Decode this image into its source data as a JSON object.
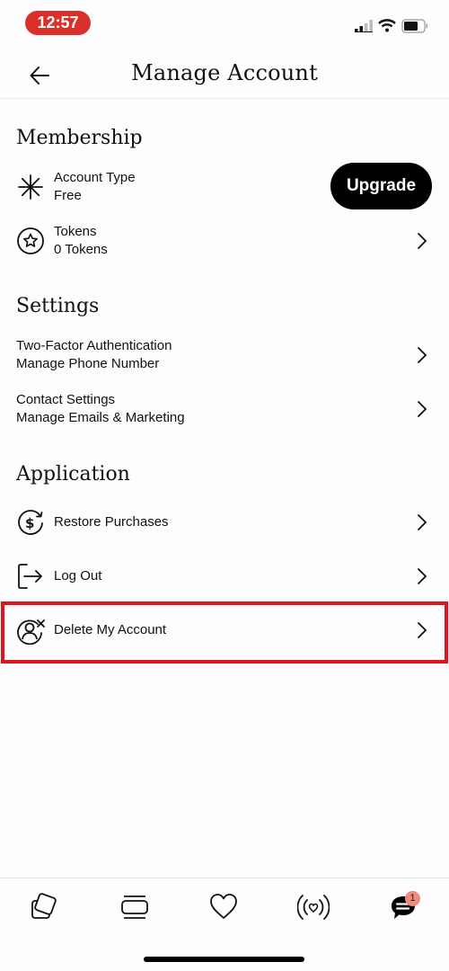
{
  "status_bar": {
    "time": "12:57",
    "time_pill_color": "#d9302c"
  },
  "header": {
    "title": "Manage Account",
    "back_icon": "arrow-left-icon"
  },
  "membership": {
    "title": "Membership",
    "account_type": {
      "label": "Account Type",
      "value": "Free",
      "icon": "asterisk-icon"
    },
    "upgrade_label": "Upgrade",
    "tokens": {
      "label": "Tokens",
      "value": "0 Tokens",
      "icon": "star-circle-icon"
    }
  },
  "settings": {
    "title": "Settings",
    "items": [
      {
        "label": "Two-Factor Authentication",
        "sublabel": "Manage Phone Number"
      },
      {
        "label": "Contact Settings",
        "sublabel": "Manage Emails & Marketing"
      }
    ]
  },
  "application": {
    "title": "Application",
    "items": [
      {
        "label": "Restore Purchases",
        "icon": "dollar-refresh-icon"
      },
      {
        "label": "Log Out",
        "icon": "logout-icon"
      },
      {
        "label": "Delete My Account",
        "icon": "user-delete-icon",
        "highlighted": true
      }
    ]
  },
  "highlight_color": "#e0141c",
  "tabbar": {
    "tabs": [
      {
        "name": "cards",
        "icon": "cards-icon"
      },
      {
        "name": "stack",
        "icon": "stack-icon"
      },
      {
        "name": "likes",
        "icon": "heart-icon"
      },
      {
        "name": "live",
        "icon": "broadcast-heart-icon"
      },
      {
        "name": "messages",
        "icon": "chat-icon",
        "badge": "1"
      }
    ],
    "badge_color": "#ef8b7c"
  }
}
